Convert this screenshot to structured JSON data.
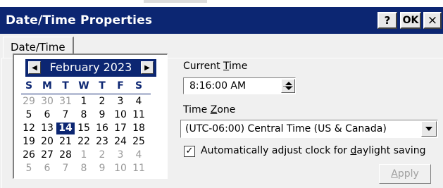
{
  "window": {
    "title": "Date/Time Properties",
    "help_label": "?",
    "ok_label": "OK",
    "close_label": "×"
  },
  "tabs": [
    {
      "label": "Date/Time",
      "active": true
    }
  ],
  "calendar": {
    "month_label": "February 2023",
    "prev_icon": "arrow-left-icon",
    "next_icon": "arrow-right-icon",
    "weekdays": [
      "S",
      "M",
      "T",
      "W",
      "T",
      "F",
      "S"
    ],
    "weeks": [
      [
        {
          "d": "29",
          "dim": true
        },
        {
          "d": "30",
          "dim": true
        },
        {
          "d": "31",
          "dim": true
        },
        {
          "d": "1"
        },
        {
          "d": "2"
        },
        {
          "d": "3"
        },
        {
          "d": "4"
        }
      ],
      [
        {
          "d": "5"
        },
        {
          "d": "6"
        },
        {
          "d": "7"
        },
        {
          "d": "8"
        },
        {
          "d": "9"
        },
        {
          "d": "10"
        },
        {
          "d": "11"
        }
      ],
      [
        {
          "d": "12"
        },
        {
          "d": "13"
        },
        {
          "d": "14",
          "selected": true
        },
        {
          "d": "15"
        },
        {
          "d": "16"
        },
        {
          "d": "17"
        },
        {
          "d": "18"
        }
      ],
      [
        {
          "d": "19"
        },
        {
          "d": "20"
        },
        {
          "d": "21"
        },
        {
          "d": "22"
        },
        {
          "d": "23"
        },
        {
          "d": "24"
        },
        {
          "d": "25"
        }
      ],
      [
        {
          "d": "26"
        },
        {
          "d": "27"
        },
        {
          "d": "28"
        },
        {
          "d": "1",
          "dim": true
        },
        {
          "d": "2",
          "dim": true
        },
        {
          "d": "3",
          "dim": true
        },
        {
          "d": "4",
          "dim": true
        }
      ],
      [
        {
          "d": "5",
          "dim": true
        },
        {
          "d": "6",
          "dim": true
        },
        {
          "d": "7",
          "dim": true
        },
        {
          "d": "8",
          "dim": true
        },
        {
          "d": "9",
          "dim": true
        },
        {
          "d": "10",
          "dim": true
        },
        {
          "d": "11",
          "dim": true
        }
      ]
    ]
  },
  "time": {
    "label_pre": "Current ",
    "label_key": "T",
    "label_post": "ime",
    "value": "8:16:00 AM"
  },
  "timezone": {
    "label_pre": "Time ",
    "label_key": "Z",
    "label_post": "one",
    "value": "(UTC-06:00) Central Time (US & Canada)"
  },
  "daylight": {
    "checked": true,
    "check_mark": "✓",
    "label_pre": "Automatically adjust clock for ",
    "label_key": "d",
    "label_post": "aylight saving"
  },
  "apply": {
    "label_key": "A",
    "label_post": "pply",
    "enabled": false
  },
  "colors": {
    "titlebar": "#0c2672",
    "face": "#f0f0f0",
    "disabled_text": "#a0a0a0"
  }
}
